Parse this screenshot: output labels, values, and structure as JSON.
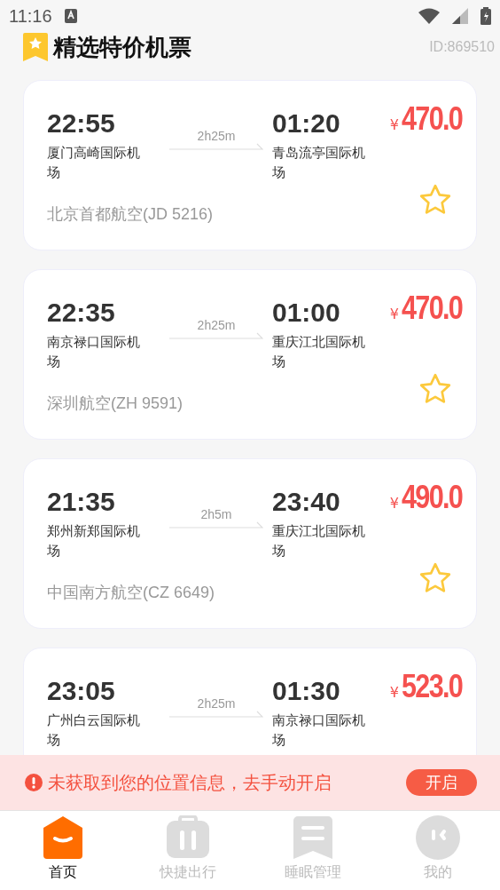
{
  "status_bar": {
    "time": "11:16"
  },
  "header": {
    "title": "精选特价机票",
    "id": "ID:869510"
  },
  "flights": [
    {
      "depart_time": "22:55",
      "depart_airport": "厦门高崎国际机场",
      "duration": "2h25m",
      "arrive_time": "01:20",
      "arrive_airport": "青岛流亭国际机场",
      "currency": "¥",
      "price": "470.0",
      "airline": "北京首都航空(JD 5216)",
      "favorite": false
    },
    {
      "depart_time": "22:35",
      "depart_airport": "南京禄口国际机场",
      "duration": "2h25m",
      "arrive_time": "01:00",
      "arrive_airport": "重庆江北国际机场",
      "currency": "¥",
      "price": "470.0",
      "airline": "深圳航空(ZH 9591)",
      "favorite": false
    },
    {
      "depart_time": "21:35",
      "depart_airport": "郑州新郑国际机场",
      "duration": "2h5m",
      "arrive_time": "23:40",
      "arrive_airport": "重庆江北国际机场",
      "currency": "¥",
      "price": "490.0",
      "airline": "中国南方航空(CZ 6649)",
      "favorite": false
    },
    {
      "depart_time": "23:05",
      "depart_airport": "广州白云国际机场",
      "duration": "2h25m",
      "arrive_time": "01:30",
      "arrive_airport": "南京禄口国际机场",
      "currency": "¥",
      "price": "523.0"
    }
  ],
  "location_banner": {
    "message": "未获取到您的位置信息，去手动开启",
    "button": "开启"
  },
  "tab_bar": [
    {
      "label": "首页",
      "kind": "home",
      "selected": true
    },
    {
      "label": "快捷出行",
      "kind": "travel",
      "selected": false
    },
    {
      "label": "睡眠管理",
      "kind": "sleep",
      "selected": false
    },
    {
      "label": "我的",
      "kind": "profile",
      "selected": false
    }
  ]
}
